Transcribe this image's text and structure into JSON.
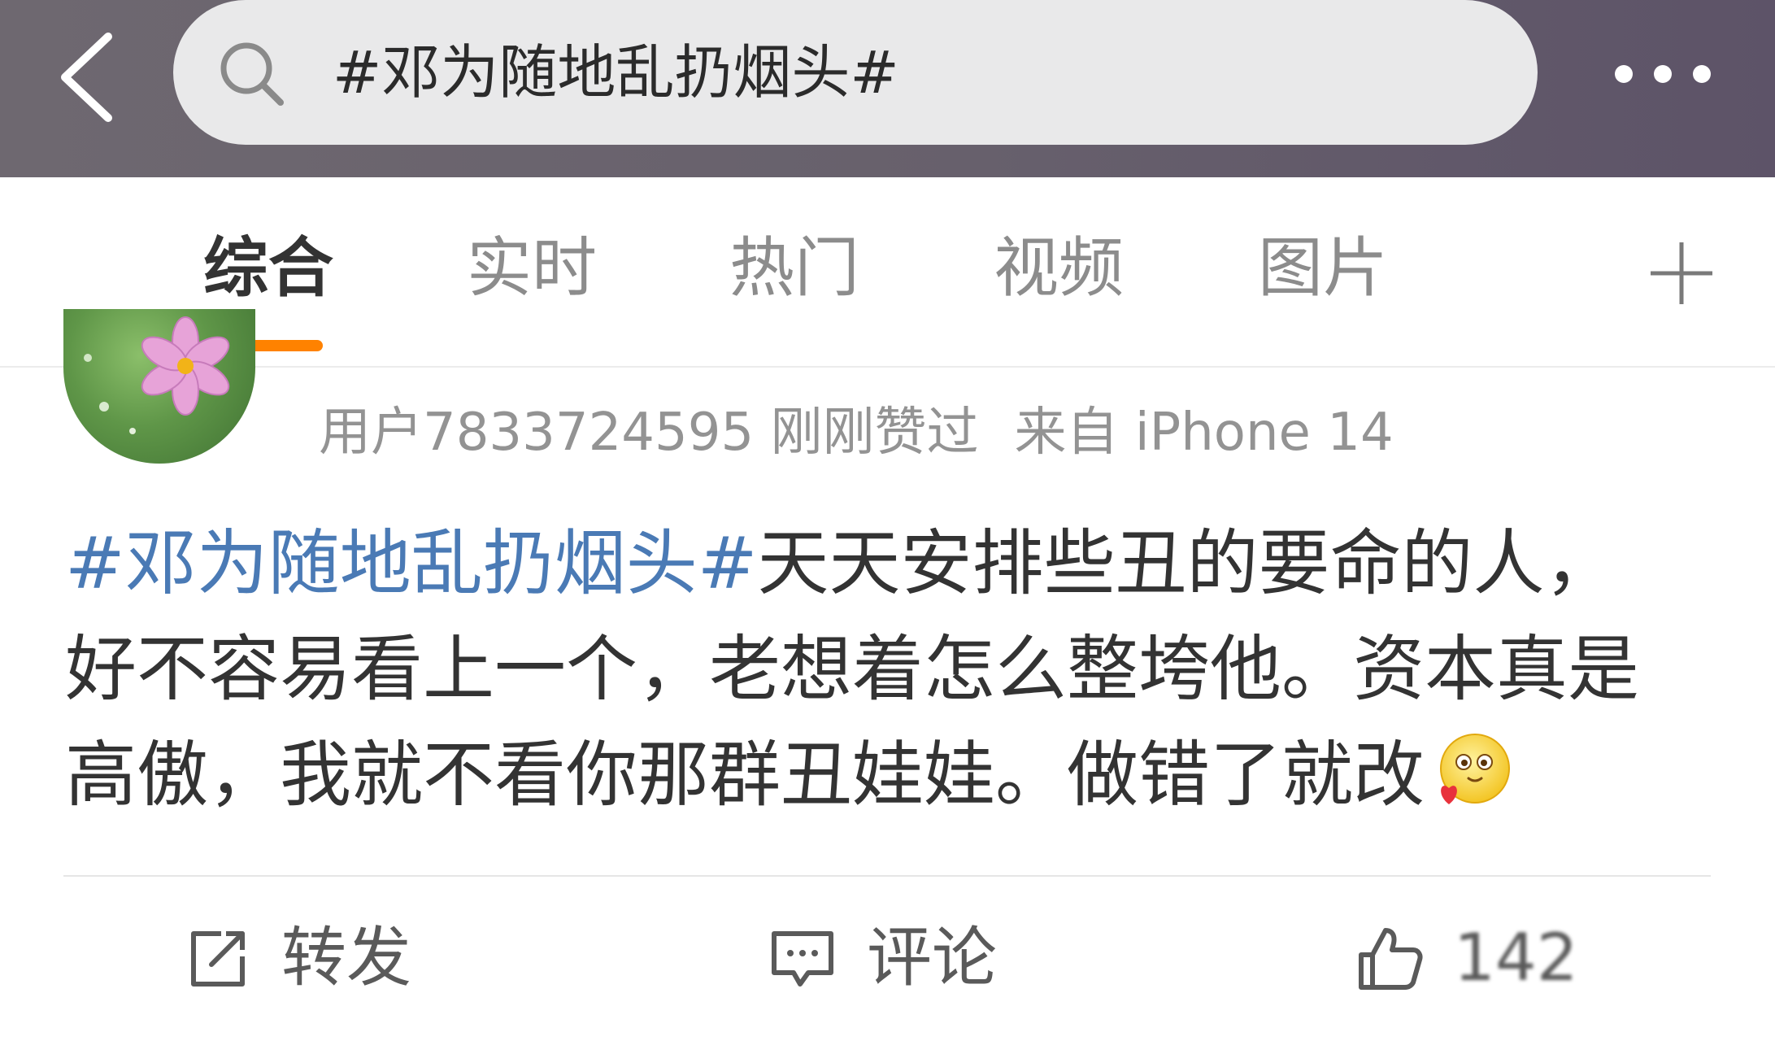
{
  "search": {
    "query": "#邓为随地乱扔烟头#"
  },
  "tabs": [
    {
      "label": "综合",
      "active": true
    },
    {
      "label": "实时",
      "active": false
    },
    {
      "label": "热门",
      "active": false
    },
    {
      "label": "视频",
      "active": false
    },
    {
      "label": "图片",
      "active": false
    }
  ],
  "post": {
    "user_line": "用户7833724595 刚刚赞过",
    "source": "来自 iPhone 14",
    "hashtag": "#邓为随地乱扔烟头#",
    "line1_rest": "天天安排些丑的要命的人，",
    "line2": "好不容易看上一个，老想着怎么整垮他。资本真是",
    "line3": "高傲，我就不看你那群丑娃娃。做错了就改",
    "emoji": "love-emoji"
  },
  "actions": {
    "repost_label": "转发",
    "comment_label": "评论",
    "like_count": "142"
  },
  "colors": {
    "accent": "#ff8200",
    "hashtag": "#4a7ab5",
    "topbar": "#67606c"
  }
}
